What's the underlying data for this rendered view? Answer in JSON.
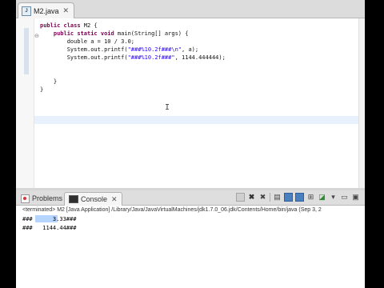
{
  "editor": {
    "tab_title": "M2.java",
    "tab_icon": "java-file-icon",
    "close_glyph": "✕",
    "lines": {
      "l1_kw": "public class",
      "l1_rest": " M2 {",
      "l2_kw": "public static void",
      "l2_rest": " main(String[] args) {",
      "l3": "double a = 10 / 3.0;",
      "l4_pre": "System.out.printf(",
      "l4_str": "\"###%10.2f###\\n\"",
      "l4_post": ", a);",
      "l5_pre": "System.out.printf(",
      "l5_str": "\"###%10.2f###\"",
      "l5_post": ", 1144.444444);",
      "l6": "}",
      "l7": "}"
    }
  },
  "views": {
    "problems_label": "Problems",
    "console_label": "Console",
    "console_close": "✕"
  },
  "console": {
    "terminated": "<terminated> M2 [Java Application] /Library/Java/JavaVirtualMachines/jdk1.7.0_06.jdk/Contents/Home/bin/java (Sep 3, 2",
    "output_line1": "###      3.33###",
    "output_line2": "###   1144.44###"
  },
  "icons": [
    "java-file-icon",
    "problems-icon",
    "console-icon",
    "stop-icon",
    "remove-launch-icon",
    "clear-console-icon",
    "scroll-lock-icon",
    "pin-console-icon",
    "display-selected-console-icon",
    "open-console-icon",
    "minimize-icon",
    "maximize-icon"
  ],
  "colors": {
    "keyword": "#7f0055",
    "string": "#2a00ff",
    "selection": "#b5d5ff",
    "current_line": "#e8f2fe"
  }
}
